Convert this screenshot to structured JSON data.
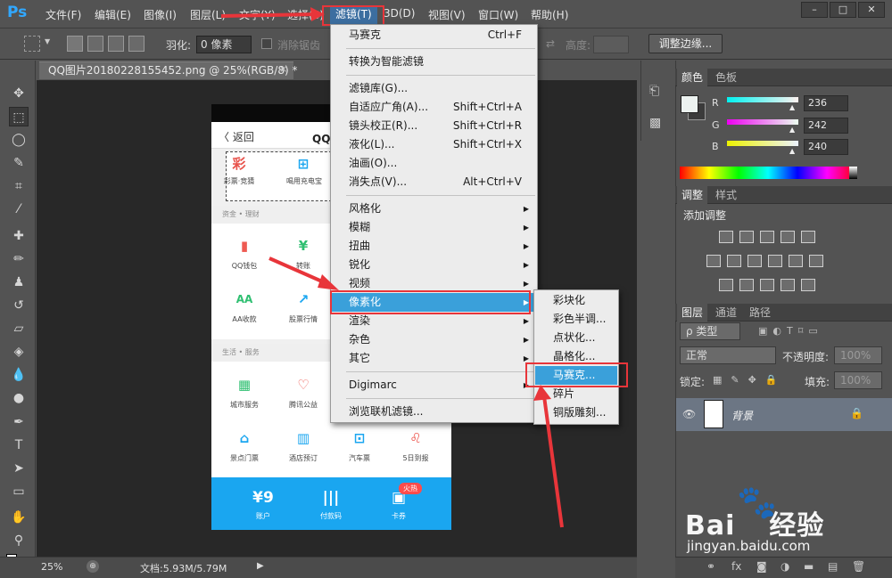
{
  "app": {
    "logo": "Ps"
  },
  "menubar": {
    "items": [
      "文件(F)",
      "编辑(E)",
      "图像(I)",
      "图层(L)",
      "文字(Y)",
      "选择(S)",
      "滤镜(T)",
      "3D(D)",
      "视图(V)",
      "窗口(W)",
      "帮助(H)"
    ],
    "active_index": 6
  },
  "window_controls": [
    "–",
    "□",
    "✕"
  ],
  "options": {
    "feather_label": "羽化:",
    "feather_value": "0 像素",
    "antialias_label": "消除锯齿",
    "height_label": "高度:",
    "refine_edge": "调整边缘..."
  },
  "document": {
    "tab_title": "QQ图片20180228155452.png @ 25%(RGB/8) *",
    "close": "×",
    "zoom": "25%",
    "doc_size": "文档:5.93M/5.79M"
  },
  "phone": {
    "back": "〈 返回",
    "title": "QQ钱",
    "top_items": [
      {
        "icon": "彩",
        "label": "彩票·竞猜",
        "color": "#e8534c"
      },
      {
        "icon": "⊞",
        "label": "喝用充电宝",
        "color": "#1aa6f0"
      }
    ],
    "section1": "资金 • 理财",
    "row1": [
      {
        "icon": "▮",
        "label": "QQ钱包",
        "color": "#ee5a52"
      },
      {
        "icon": "¥",
        "label": "转账",
        "color": "#2fbf71"
      }
    ],
    "row2": [
      {
        "icon": "AA",
        "label": "AA收款",
        "color": "#2fbf71"
      },
      {
        "icon": "↗",
        "label": "股票行情",
        "color": "#1aa6f0"
      }
    ],
    "section2": "生活 • 服务",
    "row3": [
      {
        "icon": "▦",
        "label": "城市服务",
        "color": "#2fbf71"
      },
      {
        "icon": "♡",
        "label": "腾讯公益",
        "color": "#ee5a52"
      }
    ],
    "row4": [
      {
        "icon": "⌂",
        "label": "景点门票",
        "color": "#1aa6f0"
      },
      {
        "icon": "▥",
        "label": "酒店预订",
        "color": "#1aa6f0"
      },
      {
        "icon": "⊡",
        "label": "汽车票",
        "color": "#1aa6f0"
      },
      {
        "icon": "♌",
        "label": "5日到报",
        "color": "#ee5a52"
      }
    ],
    "bottom": [
      {
        "icon": "¥9",
        "label": "账户"
      },
      {
        "icon": "|||",
        "label": "付款码"
      },
      {
        "icon": "▣",
        "label": "卡券"
      }
    ],
    "hot_badge": "火热"
  },
  "filter_menu": {
    "items": [
      {
        "label": "马赛克",
        "shortcut": "Ctrl+F"
      },
      {
        "sep": true
      },
      {
        "label": "转换为智能滤镜"
      },
      {
        "sep": true
      },
      {
        "label": "滤镜库(G)..."
      },
      {
        "label": "自适应广角(A)...",
        "shortcut": "Shift+Ctrl+A"
      },
      {
        "label": "镜头校正(R)...",
        "shortcut": "Shift+Ctrl+R"
      },
      {
        "label": "液化(L)...",
        "shortcut": "Shift+Ctrl+X"
      },
      {
        "label": "油画(O)..."
      },
      {
        "label": "消失点(V)...",
        "shortcut": "Alt+Ctrl+V"
      },
      {
        "sep": true
      },
      {
        "label": "风格化",
        "sub": true
      },
      {
        "label": "模糊",
        "sub": true
      },
      {
        "label": "扭曲",
        "sub": true
      },
      {
        "label": "锐化",
        "sub": true
      },
      {
        "label": "视频",
        "sub": true
      },
      {
        "label": "像素化",
        "sub": true,
        "highlight": true
      },
      {
        "label": "渲染",
        "sub": true
      },
      {
        "label": "杂色",
        "sub": true
      },
      {
        "label": "其它",
        "sub": true
      },
      {
        "sep": true
      },
      {
        "label": "Digimarc",
        "sub": true
      },
      {
        "sep": true
      },
      {
        "label": "浏览联机滤镜..."
      }
    ]
  },
  "pixelate_submenu": {
    "items": [
      "彩块化",
      "彩色半调...",
      "点状化...",
      "晶格化...",
      "马赛克...",
      "碎片",
      "铜版雕刻..."
    ],
    "highlight_index": 4
  },
  "color_panel": {
    "tabs": [
      "颜色",
      "色板"
    ],
    "r": {
      "label": "R",
      "value": "236"
    },
    "g": {
      "label": "G",
      "value": "242"
    },
    "b": {
      "label": "B",
      "value": "240"
    }
  },
  "adjust_panel": {
    "tabs": [
      "调整",
      "样式"
    ],
    "title": "添加调整"
  },
  "layers_panel": {
    "tabs": [
      "图层",
      "通道",
      "路径"
    ],
    "kind": "ρ 类型",
    "blend": "正常",
    "opacity_label": "不透明度:",
    "opacity": "100%",
    "lock_label": "锁定:",
    "fill_label": "填充:",
    "fill": "100%",
    "layer_name": "背景"
  },
  "watermark": {
    "brand": "Bai",
    "brand2": "经验",
    "url": "jingyan.baidu.com"
  },
  "colors": {
    "accent": "#3aa0da",
    "annotation": "#e8353a",
    "ps_blue": "#31a8ff"
  }
}
